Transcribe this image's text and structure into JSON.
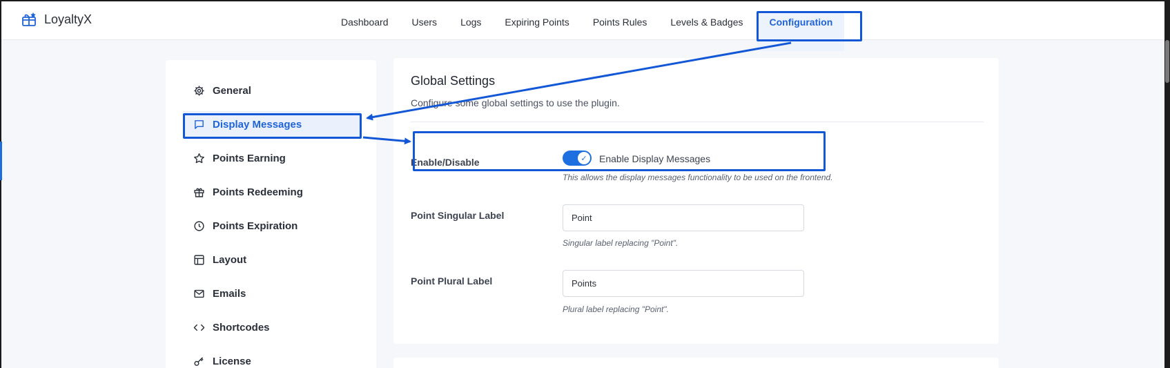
{
  "app": {
    "name": "LoyaltyX"
  },
  "nav": {
    "items": [
      {
        "label": "Dashboard"
      },
      {
        "label": "Users"
      },
      {
        "label": "Logs"
      },
      {
        "label": "Expiring Points"
      },
      {
        "label": "Points Rules"
      },
      {
        "label": "Levels & Badges"
      },
      {
        "label": "Configuration",
        "active": true
      }
    ]
  },
  "sidebar": {
    "items": [
      {
        "label": "General",
        "icon": "gear-icon"
      },
      {
        "label": "Display Messages",
        "icon": "message-icon",
        "active": true
      },
      {
        "label": "Points Earning",
        "icon": "star-icon"
      },
      {
        "label": "Points Redeeming",
        "icon": "gift-icon"
      },
      {
        "label": "Points Expiration",
        "icon": "clock-icon"
      },
      {
        "label": "Layout",
        "icon": "layout-icon"
      },
      {
        "label": "Emails",
        "icon": "mail-icon"
      },
      {
        "label": "Shortcodes",
        "icon": "code-icon"
      },
      {
        "label": "License",
        "icon": "key-icon"
      }
    ]
  },
  "main": {
    "title": "Global Settings",
    "subtitle": "Configure some global settings to use the plugin.",
    "enable": {
      "label": "Enable/Disable",
      "toggle_label": "Enable Display Messages",
      "enabled": true,
      "help": "This allows the display messages functionality to be used on the frontend."
    },
    "singular": {
      "label": "Point Singular Label",
      "value": "Point",
      "help": "Singular label replacing \"Point\"."
    },
    "plural": {
      "label": "Point Plural Label",
      "value": "Points",
      "help": "Plural label replacing \"Point\"."
    }
  },
  "colors": {
    "accent": "#1f63d6",
    "annotation": "#1257d6",
    "toggle_on": "#1e6fe0"
  }
}
